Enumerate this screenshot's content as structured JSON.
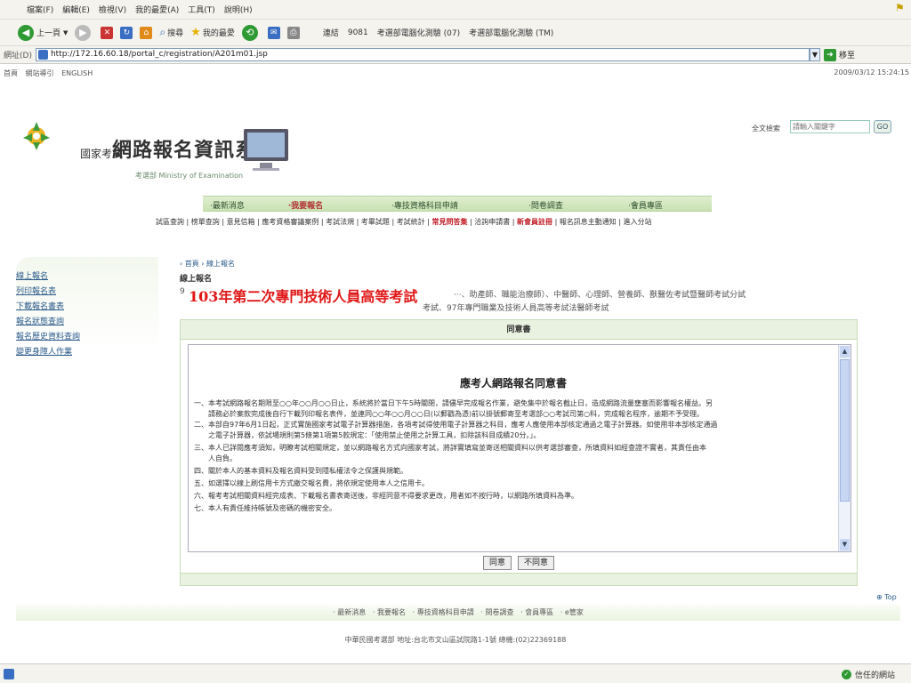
{
  "browser": {
    "menu": [
      "檔案(F)",
      "編輯(E)",
      "檢視(V)",
      "我的最愛(A)",
      "工具(T)",
      "說明(H)"
    ],
    "toolbar": {
      "back": "上一頁",
      "search": "搜尋",
      "favorites": "我的最愛"
    },
    "links": [
      "連結",
      "9081",
      "考選部電腦化測驗 (07)",
      "考選部電腦化測驗 (TM)"
    ],
    "address_label": "網址(D)",
    "url": "http://172.16.60.18/portal_c/registration/A201m01.jsp",
    "go_label": "移至",
    "status_zone": "信任的網站"
  },
  "site": {
    "top_links": [
      "首頁",
      "網站導引",
      "ENGLISH"
    ],
    "datetime": "2009/03/12 15:24:15",
    "name_prefix": "國家考試",
    "name": "網路報名資訊系統",
    "ministry": "考選部 Ministry of Examination",
    "search_label": "全文檢索",
    "search_placeholder": "請輸入關鍵字",
    "search_go": "GO"
  },
  "main_nav": [
    "‧最新消息",
    "‧我要報名",
    "‧專技資格科目申請",
    "‧問卷調查",
    "‧會員專區"
  ],
  "sub_nav": [
    {
      "text": "試區查詢",
      "hl": false
    },
    {
      "text": "榜單查詢",
      "hl": false
    },
    {
      "text": "意見信箱",
      "hl": false
    },
    {
      "text": "應考資格審議案例",
      "hl": false
    },
    {
      "text": "考試法規",
      "hl": false
    },
    {
      "text": "考畢試題",
      "hl": false
    },
    {
      "text": "考試統計",
      "hl": false
    },
    {
      "text": "常見問答集",
      "hl": true
    },
    {
      "text": "洽詢申請書",
      "hl": false
    },
    {
      "text": "新會員註冊",
      "hl": true
    },
    {
      "text": "報名訊息主動通知",
      "hl": false
    },
    {
      "text": "進入分站",
      "hl": false
    }
  ],
  "sidebar": [
    "線上報名",
    "列印報名表",
    "下載報名書表",
    "報名狀態查詢",
    "報名歷史資料查詢",
    "變更身障人作業"
  ],
  "content": {
    "breadcrumb": "› 首頁 › 線上報名",
    "section_title": "線上報名",
    "exam_prefix": "9",
    "overlay_title": "103年第二次專門技術人員高等考試",
    "exam_list_1": "‧‧‧、助產師、職能治療師）、中醫師、心理師、營養師、獸醫佐考試暨醫師考試分試",
    "exam_list_2": "考試、97年專門職業及技術人員高等考試法醫師考試",
    "panel_header": "同意書",
    "agreement_title": "應考人網路報名同意書",
    "clauses": [
      "一、本考試網路報名期限至○○年○○月○○日止，系統將於當日下午5時關閉，請儘早完成報名作業，避免集中於報名截止日，造成網路流量壅塞而影響報名權益。另",
      "　　請務必於案款完成後自行下載列印報名表件，並連同○○年○○月○○日(以郵戳為憑)前以掛號郵寄至考選部○○考試司第○科，完成報名程序，逾期不予受理。",
      "二、本部自97年6月1日起，正式實施國家考試電子計算器措施，各項考試得使用電子計算器之科目，應考人應使用本部核定通過之電子計算器。如使用非本部核定通過",
      "　　之電子計算器，依試場規則第5條第1項第5款規定：「使用禁止使用之計算工具，扣除該科目成績20分。」。",
      "三、本人已詳閱應考須知，明瞭考試相關規定，並以網路報名方式向國家考試，將詳實填寫並寄送相關資料以供考選部審查，所填資料如經查證不實者，其責任由本",
      "　　人自負。",
      "四、關於本人的基本資料及報名資料受到隱私權法令之保護與規範。",
      "五、如選擇以線上刷信用卡方式繳交報名費，將依規定使用本人之信用卡。",
      "六、報考考試相關資料經完成表、下載報名書表寄送後，非經同意不得要求更改，用者如不按行時，以網路所填資料為準。",
      "七、本人有責任維持帳號及密碼的機密安全。"
    ],
    "agree_button": "同意",
    "disagree_button": "不同意",
    "top_link": "Top"
  },
  "footer": {
    "links": [
      "最新消息",
      "我要報名",
      "專技資格科目申請",
      "問卷調查",
      "會員專區",
      "e管家"
    ],
    "address": "中華民國考選部 地址:台北市文山區試院路1-1號 總機:(02)22369188"
  }
}
